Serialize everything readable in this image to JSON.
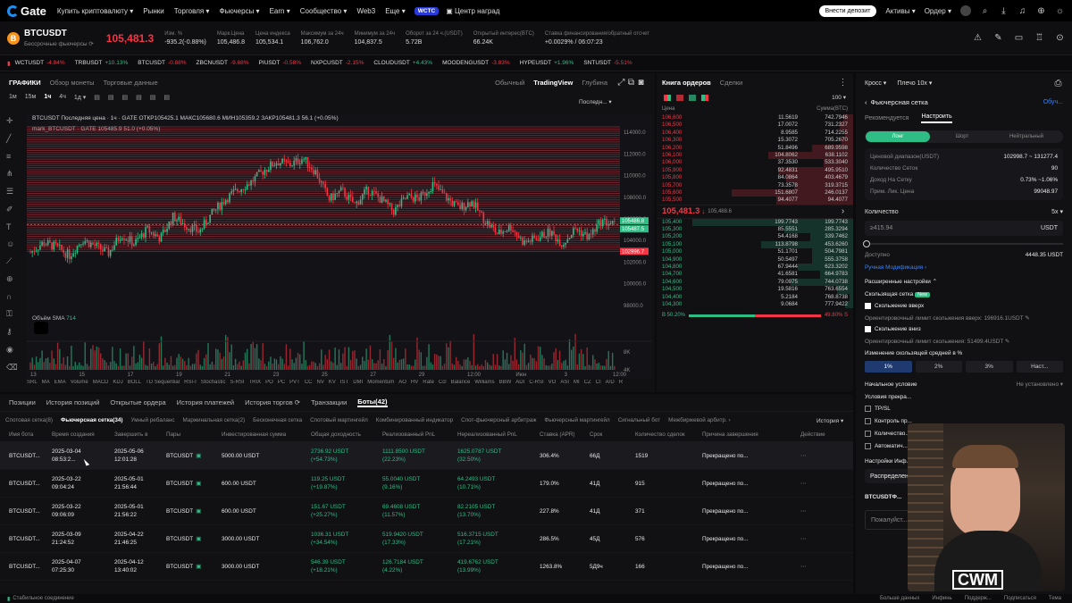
{
  "topnav": {
    "brand": "Gate",
    "items": [
      "Купить криптовалюту ▾",
      "Рынки",
      "Торговля ▾",
      "Фьючерсы ▾",
      "Earn ▾",
      "Сообщество ▾",
      "Web3",
      "Еще ▾"
    ],
    "wcrc": "WCTC",
    "rewards": "Центр наград",
    "deposit": "Внести депозит",
    "assets": "Активы ▾",
    "order": "Ордер ▾"
  },
  "ticker": {
    "coin_letter": "B",
    "symbol": "BTCUSDT",
    "subtitle": "Бессрочные фьючерсы ⟳",
    "price": "105,481.3",
    "stats": [
      {
        "label": "Изм. %",
        "value": "-935.2(-0.88%)",
        "color": "red"
      },
      {
        "label": "Марк.Цена",
        "value": "105,486.8",
        "color": "wht"
      },
      {
        "label": "Цена индекса",
        "value": "105,534.1",
        "color": "wht"
      },
      {
        "label": "Максимум за 24ч",
        "value": "106,762.0",
        "color": "wht"
      },
      {
        "label": "Минимум за 24ч",
        "value": "104,837.5",
        "color": "wht"
      },
      {
        "label": "Оборот за 24 ч.(USDT)",
        "value": "5.72B",
        "color": "wht"
      },
      {
        "label": "Открытый интерес(BTC)",
        "value": "66.24K",
        "color": "wht"
      },
      {
        "label": "Ставка финансирования/обратный отсчет",
        "value": "+0.0029% / 06:07:23",
        "color": "grn"
      }
    ]
  },
  "scroll_items": [
    {
      "s": "WCTUSDT",
      "c": "-4.84%",
      "d": "red"
    },
    {
      "s": "TRBUSDT",
      "c": "+10.13%",
      "d": "grn"
    },
    {
      "s": "BTCUSDT",
      "c": "-0.88%",
      "d": "red"
    },
    {
      "s": "ZBCNUSDT",
      "c": "-9.68%",
      "d": "red"
    },
    {
      "s": "PIUSDT",
      "c": "-0.58%",
      "d": "red"
    },
    {
      "s": "NXPCUSDT",
      "c": "-2.15%",
      "d": "red"
    },
    {
      "s": "CLOUDUSDT",
      "c": "+4.43%",
      "d": "grn"
    },
    {
      "s": "MOODENGUSDT",
      "c": "-3.83%",
      "d": "red"
    },
    {
      "s": "HYPEUSDT",
      "c": "+1.96%",
      "d": "grn"
    },
    {
      "s": "SNTUSDT",
      "c": "-5.51%",
      "d": "red"
    }
  ],
  "chart": {
    "tabs": [
      "ГРАФИКИ",
      "Обзор монеты",
      "Торговые данные"
    ],
    "views": [
      "Обычный",
      "TradingView",
      "Глубина"
    ],
    "intervals": [
      "1м",
      "15м",
      "1ч",
      "4ч",
      "1д ▾"
    ],
    "last_btn": "Последн... ▾",
    "legend1": "BTCUSDT Последняя цена · 1ч · GATE  ОТКР105425.1 МАКС105680.6 МИН105359.2 ЗАКР105481.3 56.1 (+0.05%)",
    "legend2": "mark_BTCUSDT · GATE  105485.9 51.0 (+0.05%)",
    "vol_label": "Объём SMA",
    "vol_val": "714",
    "y_ticks": [
      "114000.0",
      "112000.0",
      "110000.0",
      "108000.0",
      "106000.0",
      "104000.0",
      "102000.0",
      "100000.0",
      "98000.0"
    ],
    "tag_green1": "105486.8",
    "tag_green2": "105487.5",
    "tag_red": "102996.7",
    "vol_ticks": [
      "8K",
      "4K"
    ],
    "x_ticks": [
      "13",
      "15",
      "17",
      "19",
      "21",
      "23",
      "25",
      "27",
      "29",
      "12:00",
      "Июн",
      "3",
      "12:00"
    ],
    "indicators": [
      "SRL",
      "MA",
      "EMA",
      "Volume",
      "MACD",
      "KDJ",
      "BOLL",
      "TD Sequential",
      "RSI-I",
      "Stochastic",
      "S-RSI",
      "TRIX",
      "PO",
      "PC",
      "PVT",
      "CC",
      "NV",
      "KV",
      "IST",
      "DMI",
      "Momentum",
      "AO",
      "HV",
      "Rate",
      "Ccl",
      "Balance",
      "Williams",
      "BBW",
      "ADI",
      "C-RSI",
      "VO",
      "ASI",
      "MI",
      "CZ",
      "CI",
      "A/D",
      "R"
    ]
  },
  "chart_data": {
    "type": "candlestick",
    "title": "BTCUSDT Последняя цена · 1ч · GATE",
    "ylim": [
      97000,
      115000
    ],
    "x_ticks": [
      "13",
      "15",
      "17",
      "19",
      "21",
      "23",
      "25",
      "27",
      "29",
      "12:00",
      "Июн",
      "3",
      "12:00"
    ],
    "close_path": [
      102900,
      103800,
      103400,
      102600,
      104100,
      103500,
      102800,
      104600,
      103700,
      105000,
      104200,
      106200,
      105400,
      104800,
      106500,
      107800,
      108700,
      109400,
      110500,
      111300,
      111000,
      111600,
      110300,
      107800,
      108600,
      107300,
      108700,
      107800,
      106700,
      108000,
      107900,
      109200,
      108000,
      107000,
      107600,
      105900,
      104600,
      105300,
      103800,
      104200,
      104800,
      103700,
      105100,
      104300,
      105800,
      105481
    ]
  },
  "book": {
    "tabs": [
      "Книга ордеров",
      "Сделки"
    ],
    "depth": "100 ▾",
    "h_price": "Цена",
    "h_sum": "Сумма(BTC)",
    "asks": [
      [
        "106,600",
        "11.5619",
        "742.7946"
      ],
      [
        "106,500",
        "17.0072",
        "731.2327"
      ],
      [
        "106,400",
        "8.9585",
        "714.2255"
      ],
      [
        "106,300",
        "15.3072",
        "705.2670"
      ],
      [
        "106,200",
        "51.8496",
        "689.9598"
      ],
      [
        "106,100",
        "104.8062",
        "638.1102"
      ],
      [
        "106,000",
        "37.3530",
        "533.3040"
      ],
      [
        "105,900",
        "92.4831",
        "495.9510"
      ],
      [
        "105,800",
        "84.0864",
        "403.4679"
      ],
      [
        "105,700",
        "73.3578",
        "319.3715"
      ],
      [
        "105,600",
        "151.6807",
        "246.0137"
      ],
      [
        "105,500",
        "94.4077",
        "94.4077"
      ]
    ],
    "mid_price": "105,481.3",
    "mid_mark": "105,488.6",
    "bids": [
      [
        "105,400",
        "199.7743",
        "199.7743"
      ],
      [
        "105,300",
        "85.5551",
        "285.3294"
      ],
      [
        "105,200",
        "54.4168",
        "339.7462"
      ],
      [
        "105,100",
        "113.8798",
        "453.6260"
      ],
      [
        "105,000",
        "51.1701",
        "504.7981"
      ],
      [
        "104,900",
        "50.5497",
        "555.3758"
      ],
      [
        "104,800",
        "67.9444",
        "623.3202"
      ],
      [
        "104,700",
        "41.6581",
        "664.9783"
      ],
      [
        "104,600",
        "79.0975",
        "744.0738"
      ],
      [
        "104,500",
        "19.5816",
        "763.6554"
      ],
      [
        "104,400",
        "5.2184",
        "768.8738"
      ],
      [
        "104,300",
        "9.0684",
        "777.9422"
      ]
    ],
    "buy_pct": "B 50.20%",
    "sell_pct": "49.80% S",
    "ask_bars": [
      5,
      7,
      4,
      6,
      21,
      43,
      15,
      38,
      34,
      30,
      62,
      39
    ],
    "bid_bars": [
      82,
      35,
      22,
      47,
      21,
      21,
      28,
      17,
      32,
      8,
      2,
      4
    ]
  },
  "grid": {
    "margin_mode": "Кросс ▾",
    "leverage": "Плечо 10x ▾",
    "title": "Фьючерсная сетка",
    "more": "Обуч...",
    "tab_rec": "Рекомендуется",
    "tab_set": "Настроить",
    "sides": [
      "Лонг",
      "Шорт",
      "Нейтральный"
    ],
    "params": [
      [
        "Ценовой диапазон(USDT)",
        "102998.7 ~ 131277.4"
      ],
      [
        "Количество Сеток",
        "90"
      ],
      [
        "Доход На Сетку",
        "0.73% ~1.06%"
      ],
      [
        "Прим. Лик. Цена",
        "99048.97"
      ]
    ],
    "qty_label": "Количество",
    "qty_mult": "5x ▾",
    "qty_ph": "≥415.94",
    "qty_cur": "USDT",
    "avail_label": "Доступно",
    "avail_val": "4448.35 USDT",
    "manual": "Ручная Модификация ›",
    "adv": "Расширенные настройки ⌃",
    "trail": "Скользящая сетка",
    "new": "New",
    "up_label": "Скольжение вверх",
    "up_limit": "Ориентировочный лимит скольжения вверх: 196916.1USDT ✎",
    "down_label": "Скольжение вниз",
    "down_limit": "Ориентировочный лимит скольжения: 51499.4USDT ✎",
    "avg_label": "Изменение скользящей средней в %",
    "avg_opts": [
      "1%",
      "2%",
      "3%",
      "Наст..."
    ],
    "start_label": "Начальное условие",
    "start_val": "Не установлено ▾",
    "stop_label": "Условия прекра...",
    "opts": [
      "TP/SL",
      "Контроль пр...",
      "Количество...",
      "Автоматич..."
    ],
    "info": "Настройки Инф...",
    "distr": "Распределен...",
    "sym": "BTCUSDTФ...",
    "ask": "Пожалуйст...",
    "overlay": "CWM"
  },
  "bottom": {
    "tabs": [
      "Позиции",
      "История позиций",
      "Открытые ордера",
      "История платежей",
      "История торгов ⟳",
      "Транзакции",
      "Боты(42)"
    ],
    "sub": [
      "Спотовая сетка(8)",
      "Фьючерсная сетка(34)",
      "Умный ребаланс",
      "Маржинальная сетка(2)",
      "Бесконечная сетка",
      "Спотовый мартингейл",
      "Комбинированный индикатор",
      "Спот-фьючерсный арбитраж",
      "Фьючерсный мартингейл",
      "Сигнальный бот",
      "Межбиржевой арбитр. ›"
    ],
    "history": "История ▾",
    "cols": [
      "Имя бота",
      "Время создания",
      "Завершить в",
      "Пары",
      "Инвестированная сумма",
      "Общая доходность",
      "Реализованный PnL",
      "Нереализованный PnL",
      "Ставка (APR)",
      "Срок",
      "Количество сделок",
      "Причина завершения",
      "Действие"
    ],
    "rows": [
      [
        "BTCUSDT...",
        "2025-03-04",
        "08:53:2...",
        "2025-05-06",
        "12:01:28",
        "BTCUSDT",
        "5000.00 USDT",
        "2736.92 USDT",
        "(+54.73%)",
        "1111.8500 USDT",
        "(22.23%)",
        "1625.0787 USDT",
        "(32.50%)",
        "306.4%",
        "66Д",
        "1519",
        "Прекращено по..."
      ],
      [
        "BTCUSDT...",
        "2025-03-22",
        "09:04:24",
        "2025-05-01",
        "21:56:44",
        "BTCUSDT",
        "600.00 USDT",
        "119.25 USDT",
        "(+19.87%)",
        "55.0040 USDT",
        "(9.16%)",
        "64.2493 USDT",
        "(10.71%)",
        "179.0%",
        "41Д",
        "915",
        "Прекращено по..."
      ],
      [
        "BTCUSDT...",
        "2025-03-22",
        "09:06:09",
        "2025-05-01",
        "21:56:22",
        "BTCUSDT",
        "600.00 USDT",
        "151.67 USDT",
        "(+25.27%)",
        "69.4608 USDT",
        "(11.57%)",
        "82.2105 USDT",
        "(13.70%)",
        "227.8%",
        "41Д",
        "371",
        "Прекращено по..."
      ],
      [
        "BTCUSDT...",
        "2025-03-09",
        "21:24:52",
        "2025-04-22",
        "21:46:25",
        "BTCUSDT",
        "3000.00 USDT",
        "1036.31 USDT",
        "(+34.54%)",
        "519.9420 USDT",
        "(17.33%)",
        "516.3715 USDT",
        "(17.21%)",
        "286.5%",
        "45Д",
        "576",
        "Прекращено по..."
      ],
      [
        "BTCUSDT...",
        "2025-04-07",
        "07:25:30",
        "2025-04-12",
        "13:40:02",
        "BTCUSDT",
        "3000.00 USDT",
        "546.39 USDT",
        "(+18.21%)",
        "126.7184 USDT",
        "(4.22%)",
        "419.6762 USDT",
        "(13.99%)",
        "1263.8%",
        "5Д9ч",
        "166",
        "Прекращено по..."
      ]
    ]
  },
  "status": {
    "text": "Стабильное соединение",
    "right": [
      "Больше данных",
      "Инфинь",
      "Поддерж...",
      "Подписаться",
      "Тема"
    ]
  }
}
